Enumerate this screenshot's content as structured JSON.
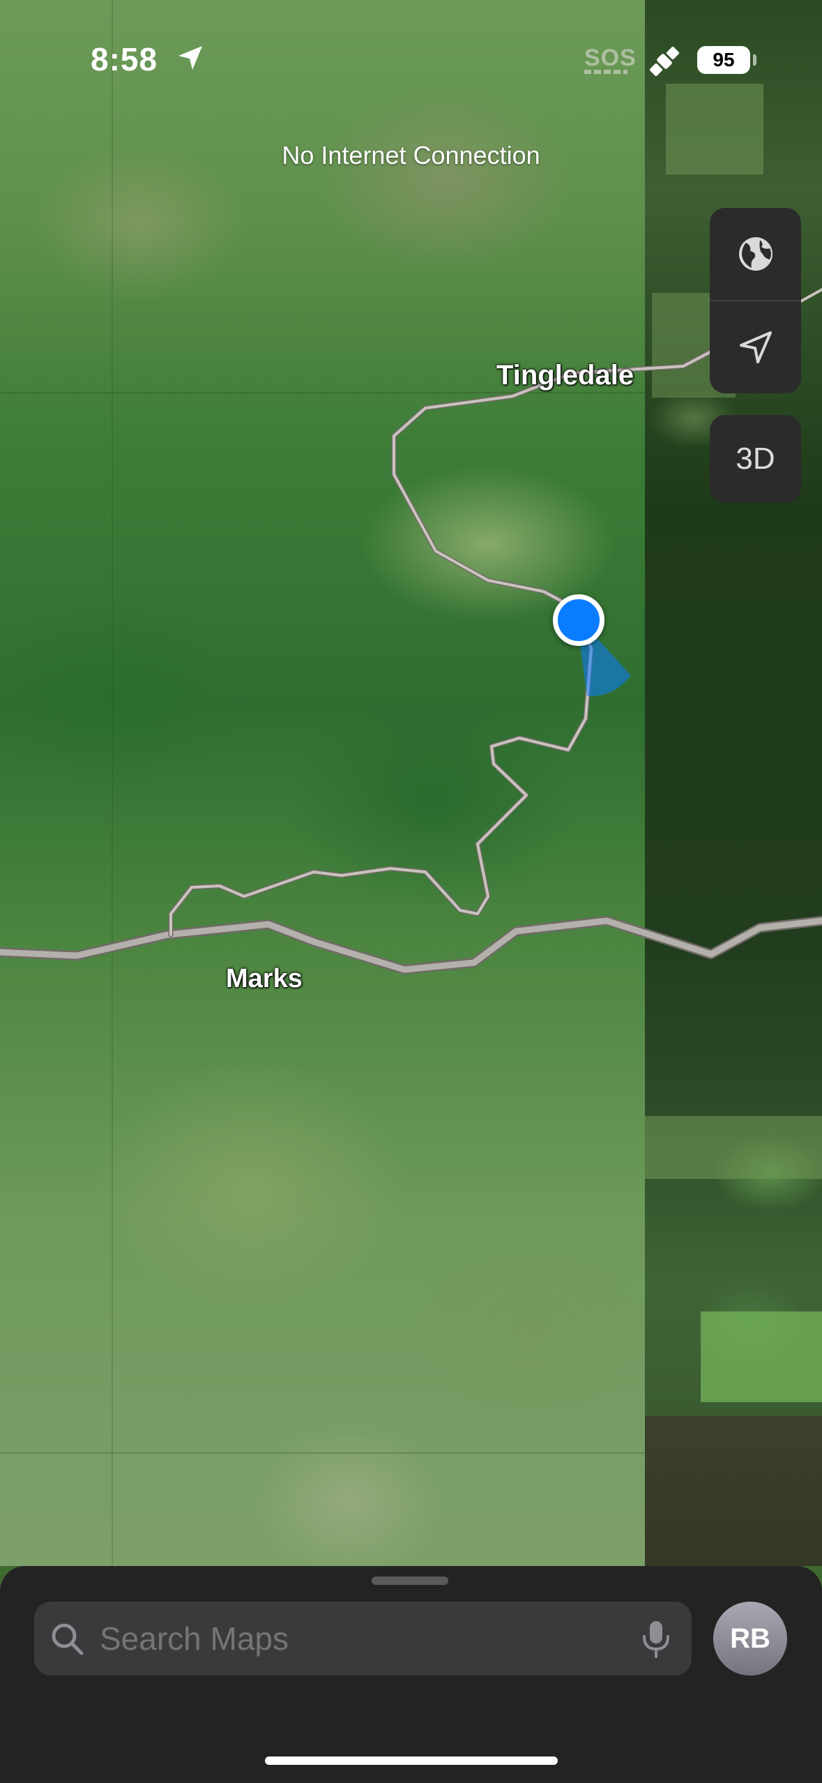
{
  "status_bar": {
    "time": "8:58",
    "sos": "SOS",
    "battery": "95",
    "icons": [
      "location-arrow-icon",
      "satellite-icon"
    ]
  },
  "banner": {
    "text": "No Internet Connection"
  },
  "map": {
    "type": "satellite",
    "places": {
      "north": "Tingledale",
      "south": "Marks"
    }
  },
  "controls": {
    "icons": [
      "globe-icon",
      "location-arrow-icon"
    ],
    "three_d_label": "3D"
  },
  "sheet": {
    "search_placeholder": "Search Maps",
    "search_icon": "search-icon",
    "mic_icon": "microphone-icon",
    "avatar_initials": "RB"
  },
  "colors": {
    "accent": "#0A7CFF",
    "sheet_bg": "#232324",
    "control_bg": "#2B2B2C",
    "road": "#B4B0AC"
  }
}
